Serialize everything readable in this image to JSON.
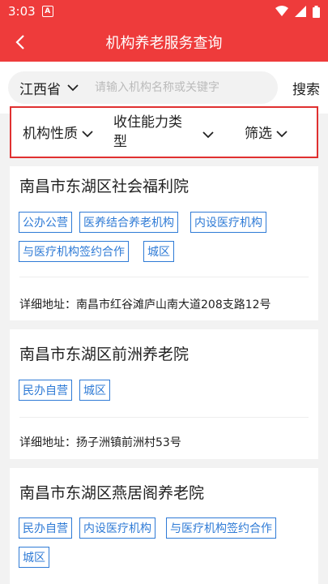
{
  "status": {
    "time": "3:03",
    "notif_letter": "A"
  },
  "header": {
    "title": "机构养老服务查询"
  },
  "search": {
    "province": "江西省",
    "placeholder": "请输入机构名称或关键字",
    "button": "搜索"
  },
  "filters": {
    "nature": "机构性质",
    "capacity_line1": "收住能力类",
    "capacity_line2": "型",
    "screen": "筛选"
  },
  "addr_label": "详细地址：",
  "institutions": [
    {
      "name": "南昌市东湖区社会福利院",
      "tags": [
        "公办公营",
        "医养结合养老机构",
        "内设医疗机构",
        "与医疗机构签约合作",
        "城区"
      ],
      "address": "南昌市红谷滩庐山南大道208支路12号"
    },
    {
      "name": "南昌市东湖区前洲养老院",
      "tags": [
        "民办自营",
        "城区"
      ],
      "address": "扬子洲镇前洲村53号"
    },
    {
      "name": "南昌市东湖区燕居阁养老院",
      "tags": [
        "民办自营",
        "内设医疗机构",
        "与医疗机构签约合作",
        "城区"
      ]
    }
  ],
  "colors": {
    "primary": "#ee3b3b",
    "tag": "#2f7bd6",
    "highlight_border": "#e03030"
  }
}
